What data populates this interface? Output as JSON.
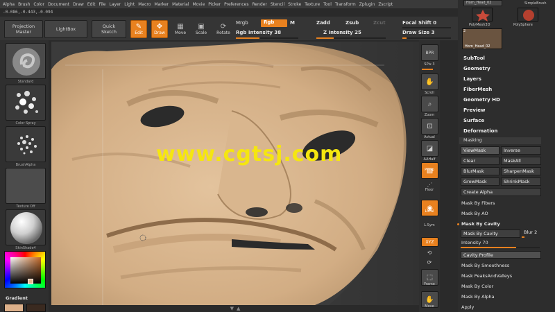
{
  "menu": [
    "Alpha",
    "Brush",
    "Color",
    "Document",
    "Draw",
    "Edit",
    "File",
    "Layer",
    "Light",
    "Macro",
    "Marker",
    "Material",
    "Movie",
    "Picker",
    "Preferences",
    "Render",
    "Stencil",
    "Stroke",
    "Texture",
    "Tool",
    "Transform",
    "Zplugin",
    "Zscript"
  ],
  "coords": "-0.086,-0.443,-0.094",
  "shelf": {
    "projection_master": "Projection\nMaster",
    "lightbox": "LightBox",
    "quick_sketch": "Quick\nSketch",
    "edit": "Edit",
    "draw": "Draw",
    "move": "Move",
    "scale": "Scale",
    "rotate": "Rotate",
    "mrgb": "Mrgb",
    "rgb": "Rgb",
    "m": "M",
    "rgb_intensity": "Rgb Intensity 38",
    "zadd": "Zadd",
    "zsub": "Zsub",
    "zcut": "Zcut",
    "z_intensity": "Z Intensity 25",
    "focal_shift": "Focal Shift 0",
    "draw_size": "Draw Size 3"
  },
  "left_tray": {
    "brushes": [
      {
        "label": "Standard"
      },
      {
        "label": "Color  Spray"
      },
      {
        "label": "BrushAlpha"
      },
      {
        "label": "Texture  Off"
      },
      {
        "label": "SkinShade4"
      }
    ],
    "gradient_label": "Gradient"
  },
  "watermark": "www.cgtsj.com",
  "right_strip": [
    {
      "label": "BPR",
      "icon": "bpr-icon"
    },
    {
      "label": "SPix 3",
      "icon": ""
    },
    {
      "label": "Scroll",
      "icon": "hand-icon"
    },
    {
      "label": "Zoom",
      "icon": "zoom-icon"
    },
    {
      "label": "Actual",
      "icon": "actual-icon"
    },
    {
      "label": "AAHalf",
      "icon": "aahalf-icon"
    },
    {
      "label": "Persp",
      "icon": "persp-icon"
    },
    {
      "label": "Floor",
      "icon": "floor-icon"
    },
    {
      "label": "Local",
      "icon": "local-icon"
    },
    {
      "label": "L.Sym",
      "icon": "lsym-icon"
    },
    {
      "label": "XYZ",
      "icon": "xyz-icon"
    },
    {
      "label": "Frame",
      "icon": "frame-icon"
    },
    {
      "label": "Move",
      "icon": "move-icon"
    }
  ],
  "tool_palette": {
    "top_name": "Horn_Head_02",
    "simplebrush": "SimpleBrush",
    "polymesh3d": "PolyMesh3D",
    "polysphere": "PolySphere",
    "count": "2",
    "horn_head": "Horn_Head_02"
  },
  "subpalettes": [
    "SubTool",
    "Geometry",
    "Layers",
    "FiberMesh",
    "Geometry HD",
    "Preview",
    "Surface",
    "Deformation"
  ],
  "masking": {
    "title": "Masking",
    "pairs": [
      [
        "ViewMask",
        "Inverse"
      ],
      [
        "Clear",
        "MaskAll"
      ],
      [
        "BlurMask",
        "SharpenMask"
      ],
      [
        "GrowMask",
        "ShrinkMask"
      ]
    ],
    "create_alpha": "Create Alpha",
    "mask_by_fibers": "Mask By Fibers",
    "mask_by_ao": "Mask By AO",
    "mask_by_cavity": "Mask By Cavity",
    "mask_by_cavity_btn": "Mask By Cavity",
    "blur": "Blur 2",
    "intensity": "Intensity 70",
    "cavity_profile": "Cavity Profile",
    "mask_by_smoothness": "Mask By Smoothness",
    "mask_peaks": "Mask PeaksAndValleys",
    "mask_by_color": "Mask By Color",
    "mask_by_alpha": "Mask By Alpha",
    "apply": "Apply"
  },
  "colors": {
    "accent": "#e8811f",
    "skin": "#d7b58f",
    "watermark": "#f5e610"
  }
}
